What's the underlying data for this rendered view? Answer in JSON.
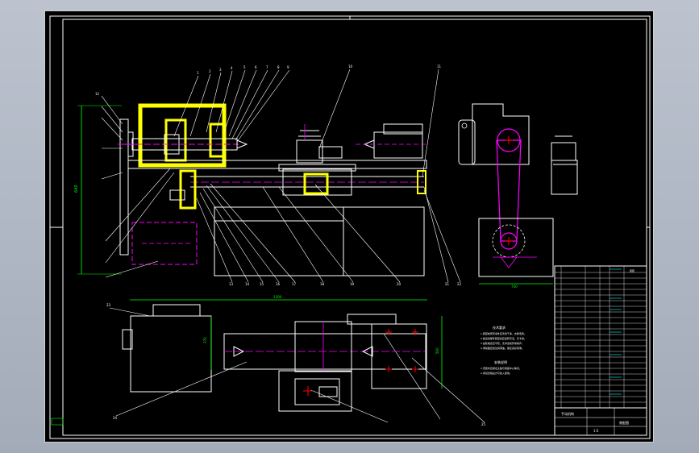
{
  "drawing": {
    "overall_width_dim": "1300",
    "overall_height_dim": "640",
    "base_width_dim": "740",
    "side_width_dim": "500",
    "tailstock_height_dim": "370",
    "height_dim_2": "500",
    "corner_mark": "装配",
    "tech_heading": "技术要求",
    "tech_heading_2": "安装说明",
    "tech_lines": [
      "1.装配前所有零件应清洗干净，去除毛刺。",
      "2.各运动部件装配后应运转灵活，无卡滞。",
      "3.齿轮啮合应平稳，无冲击和异常噪声。",
      "4.滑动面应加注润滑油，保证良好润滑。"
    ],
    "install_lines": [
      "1.安装时应保证主轴与尾座中心等高。",
      "2.调试合格后方可投入使用。"
    ],
    "title_block": {
      "drawing_title": "手动机构",
      "material_label": "装配图",
      "scale": "1:5"
    },
    "balloons_top": [
      "1",
      "2",
      "3",
      "4",
      "5",
      "6",
      "7",
      "8",
      "9",
      "10",
      "11",
      "12"
    ],
    "balloons_bottom": [
      "13",
      "14",
      "15",
      "16",
      "17",
      "18",
      "19",
      "20",
      "21",
      "22",
      "23",
      "24",
      "25"
    ]
  }
}
